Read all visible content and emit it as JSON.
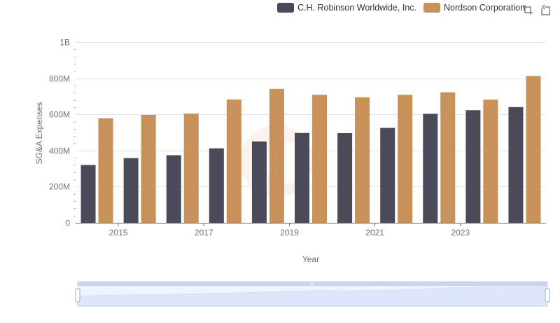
{
  "legend": {
    "items": [
      {
        "label": "C.H. Robinson Worldwide, Inc.",
        "color": "#4a4a58"
      },
      {
        "label": "Nordson Corporation",
        "color": "#c8915a"
      }
    ]
  },
  "toolbox": {
    "icons": [
      "zoom-icon",
      "restore-icon"
    ]
  },
  "chart_data": {
    "type": "bar",
    "categories": [
      "2014",
      "2015",
      "2016",
      "2017",
      "2018",
      "2019",
      "2020",
      "2021",
      "2022",
      "2023",
      "2024"
    ],
    "x_tick_labels": [
      "2015",
      "2017",
      "2019",
      "2021",
      "2023"
    ],
    "xlabel": "Year",
    "ylabel": "SG&A Expenses",
    "ylim": [
      0,
      1000000000
    ],
    "y_tick_labels": [
      "0",
      "200M",
      "400M",
      "600M",
      "800M",
      "1B"
    ],
    "y_tick_values": [
      0,
      200000000,
      400000000,
      600000000,
      800000000,
      1000000000
    ],
    "grid": true,
    "legend_position": "top-right",
    "series": [
      {
        "name": "C.H. Robinson Worldwide, Inc.",
        "color": "#4a4a58",
        "values": [
          320000000,
          358000000,
          374000000,
          412000000,
          450000000,
          497000000,
          496000000,
          525000000,
          603000000,
          623000000,
          640000000
        ]
      },
      {
        "name": "Nordson Corporation",
        "color": "#c8915a",
        "values": [
          578000000,
          597000000,
          604000000,
          682000000,
          741000000,
          708000000,
          694000000,
          708000000,
          722000000,
          681000000,
          812000000
        ]
      }
    ]
  },
  "data_zoom": {
    "range_start": 0,
    "range_end": 100
  }
}
